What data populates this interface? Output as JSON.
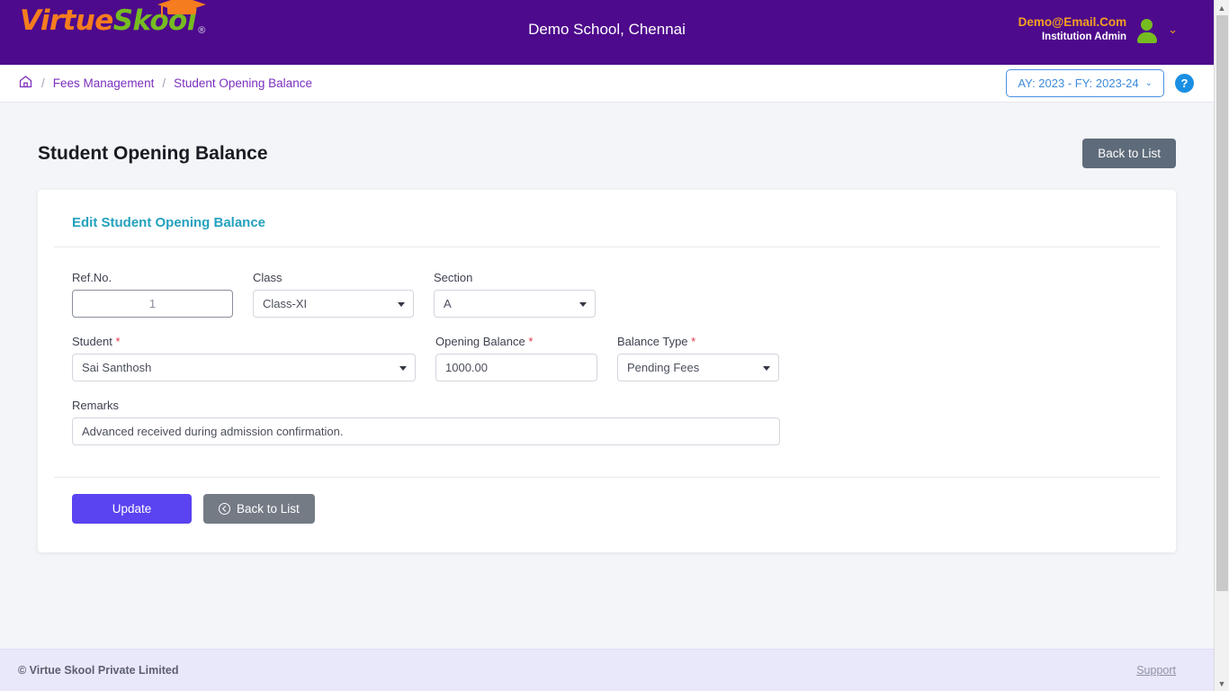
{
  "header": {
    "logo_primary": "Virtue",
    "logo_secondary": "Skool",
    "logo_registered": "®",
    "school_name": "Demo School, Chennai",
    "user_email": "Demo@Email.Com",
    "user_role": "Institution Admin",
    "colors": {
      "bar": "#4d0a8c",
      "logo_primary": "#f57c1f",
      "logo_secondary": "#76bc21",
      "email": "#f5a01f"
    }
  },
  "breadcrumb": {
    "home_icon": "home-icon",
    "separator": "/",
    "items": [
      {
        "label": "Fees Management"
      },
      {
        "label": "Student Opening Balance"
      }
    ],
    "academic_year": "AY: 2023 - FY: 2023-24",
    "academic_year_chevron": "⌄",
    "help_label": "?",
    "link_color": "#7b2fbe",
    "ay_color": "#3d8bdb"
  },
  "page": {
    "title": "Student Opening Balance",
    "back_to_list_top": "Back to List"
  },
  "card": {
    "title": "Edit Student Opening Balance",
    "title_color": "#23a1bd",
    "fields": {
      "refno": {
        "label": "Ref.No.",
        "value": "1",
        "required": false
      },
      "class": {
        "label": "Class",
        "value": "Class-XI",
        "required": false
      },
      "section": {
        "label": "Section",
        "value": "A",
        "required": false
      },
      "student": {
        "label": "Student",
        "value": "Sai Santhosh",
        "required": true
      },
      "opening_balance": {
        "label": "Opening Balance",
        "value": "1000.00",
        "required": true
      },
      "balance_type": {
        "label": "Balance Type",
        "value": "Pending Fees",
        "required": true
      },
      "remarks": {
        "label": "Remarks",
        "value": "Advanced received during admission confirmation.",
        "required": false
      }
    },
    "required_marker": "*",
    "actions": {
      "update": "Update",
      "back_to_list": "Back to List",
      "back_icon": "circle-arrow-left-icon"
    },
    "button_colors": {
      "update": "#5a43f0",
      "back": "#747b85"
    }
  },
  "footer": {
    "copyright": "© Virtue Skool Private Limited",
    "support": "Support",
    "background": "#e9e7fa"
  },
  "scrollbar": {
    "up_arrow": "▲",
    "down_arrow": "▼"
  }
}
